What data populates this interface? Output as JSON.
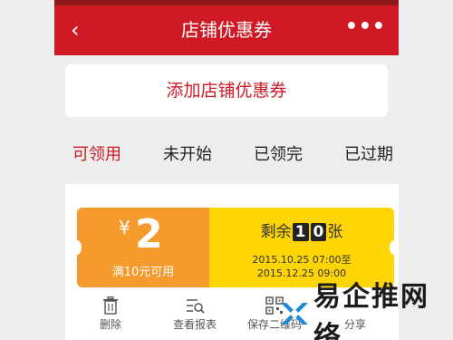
{
  "header": {
    "back_icon": "‹",
    "title": "店铺优惠券",
    "more_icon": "•••"
  },
  "add_coupon": {
    "label": "添加店铺优惠券"
  },
  "tabs": [
    {
      "label": "可领用",
      "active": true
    },
    {
      "label": "未开始",
      "active": false
    },
    {
      "label": "已领完",
      "active": false
    },
    {
      "label": "已过期",
      "active": false
    }
  ],
  "coupon": {
    "currency": "¥",
    "amount": "2",
    "condition": "满10元可用",
    "remaining_prefix": "剩余",
    "remaining_digit_1": "1",
    "remaining_digit_2": "0",
    "remaining_suffix": "张",
    "valid_from": "2015.10.25 07:00至",
    "valid_to": "2015.12.25 09:00"
  },
  "actions": [
    {
      "label": "删除",
      "icon": "trash-icon"
    },
    {
      "label": "查看报表",
      "icon": "report-list-icon"
    },
    {
      "label": "保存二维码",
      "icon": "qrcode-icon"
    },
    {
      "label": "分享",
      "icon": "share-icon"
    }
  ],
  "watermark": {
    "text": "易企推网络"
  },
  "colors": {
    "brand_red": "#cf1a26",
    "coupon_orange": "#f59a2c",
    "coupon_yellow": "#fdd404"
  }
}
